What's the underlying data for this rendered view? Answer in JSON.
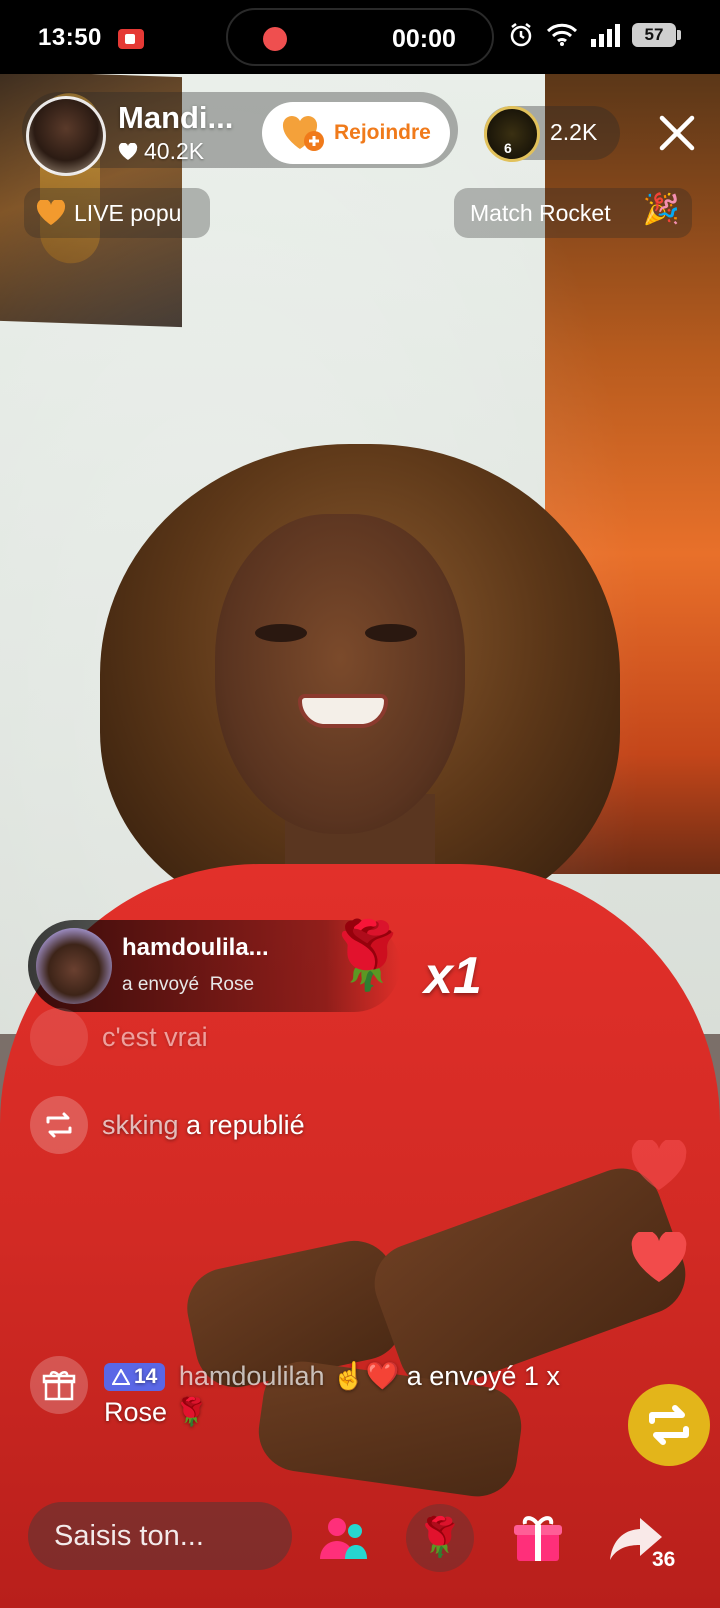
{
  "status_bar": {
    "time": "13:50",
    "record_timer": "00:00",
    "battery": "57",
    "icons": [
      "screen-record-icon",
      "alarm-icon",
      "wifi-icon",
      "signal-icon",
      "battery-icon"
    ]
  },
  "host": {
    "name": "Mandi...",
    "likes": "40.2K",
    "join_label": "Rejoindre"
  },
  "viewers": {
    "rank_badge": "6",
    "count": "2.2K"
  },
  "tags": {
    "live_popular": "LIVE popu",
    "match_rocket": "Match Rocket"
  },
  "gift_banner": {
    "username": "hamdoulila...",
    "action": "a envoyé",
    "gift": "Rose",
    "multiplier": "x1"
  },
  "comments": [
    {
      "text": "c'est vrai"
    },
    {
      "user": "skking",
      "action": "a republié"
    }
  ],
  "gift_message": {
    "level": "14",
    "user": "hamdoulilah",
    "action": "a envoyé 1 x",
    "gift": "Rose"
  },
  "bottom_bar": {
    "input_placeholder": "Saisis ton...",
    "share_count": "36"
  },
  "colors": {
    "join_accent": "#f07a1a",
    "heart": "#f24b4b",
    "repost_float": "#e3b51a",
    "level_badge": "#5a67e6",
    "pink_action": "#ff2f7a",
    "teal_action": "#27d6d0"
  }
}
